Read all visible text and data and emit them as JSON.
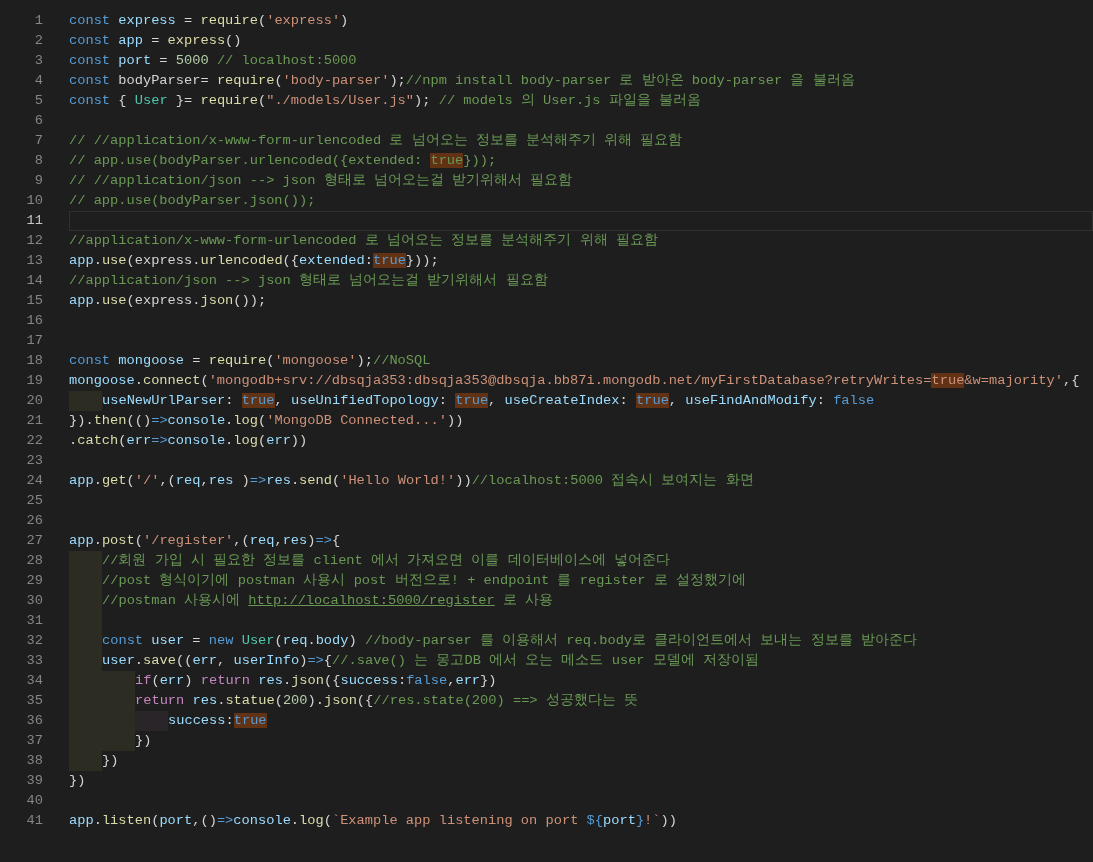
{
  "editor": {
    "lines": [
      {
        "number": "1",
        "current": false,
        "tokens": [
          {
            "text": "const",
            "kind": "keyword"
          },
          {
            "text": " express",
            "kind": "variable"
          },
          {
            "text": " = ",
            "kind": "plain"
          },
          {
            "text": "require",
            "kind": "function"
          },
          {
            "text": "(",
            "kind": "plain"
          },
          {
            "text": "'express'",
            "kind": "string"
          },
          {
            "text": ")",
            "kind": "plain"
          }
        ]
      },
      {
        "number": "2",
        "current": false,
        "tokens": [
          {
            "text": "const",
            "kind": "keyword"
          },
          {
            "text": " app",
            "kind": "variable"
          },
          {
            "text": " = ",
            "kind": "plain"
          },
          {
            "text": "express",
            "kind": "function"
          },
          {
            "text": "()",
            "kind": "plain"
          }
        ]
      },
      {
        "number": "3",
        "current": false,
        "tokens": [
          {
            "text": "const",
            "kind": "keyword"
          },
          {
            "text": " port",
            "kind": "variable"
          },
          {
            "text": " = ",
            "kind": "plain"
          },
          {
            "text": "5000",
            "kind": "number"
          },
          {
            "text": " // localhost:5000",
            "kind": "comment"
          }
        ]
      },
      {
        "number": "4",
        "current": false,
        "tokens": [
          {
            "text": "const",
            "kind": "keyword"
          },
          {
            "text": " bodyParser",
            "kind": "plain"
          },
          {
            "text": "= ",
            "kind": "plain"
          },
          {
            "text": "require",
            "kind": "function"
          },
          {
            "text": "(",
            "kind": "plain"
          },
          {
            "text": "'body-parser'",
            "kind": "string"
          },
          {
            "text": ");",
            "kind": "plain"
          },
          {
            "text": "//npm install body-parser 로 받아온 body-parser 을 불러옴",
            "kind": "comment"
          }
        ]
      },
      {
        "number": "5",
        "current": false,
        "tokens": [
          {
            "text": "const",
            "kind": "keyword"
          },
          {
            "text": " { ",
            "kind": "plain"
          },
          {
            "text": "User",
            "kind": "class"
          },
          {
            "text": " }= ",
            "kind": "plain"
          },
          {
            "text": "require",
            "kind": "function"
          },
          {
            "text": "(",
            "kind": "plain"
          },
          {
            "text": "\"./models/User.js\"",
            "kind": "string"
          },
          {
            "text": "); ",
            "kind": "plain"
          },
          {
            "text": "// models 의 User.js 파일을 불러옴",
            "kind": "comment"
          }
        ]
      },
      {
        "number": "6",
        "current": false
      },
      {
        "number": "7",
        "current": false,
        "tokens": [
          {
            "text": "// //application/x-www-form-urlencoded 로 넘어오는 정보를 분석해주기 위해 필요함",
            "kind": "comment"
          }
        ]
      },
      {
        "number": "8",
        "current": false,
        "tokens": [
          {
            "text": "// app.use(bodyParser.urlencoded({extended: ",
            "kind": "comment"
          },
          {
            "text": "true",
            "kind": "comment-match"
          },
          {
            "text": "}));",
            "kind": "comment"
          }
        ]
      },
      {
        "number": "9",
        "current": false,
        "tokens": [
          {
            "text": "// //application/json --> json 형태로 넘어오는걸 받기위해서 필요함",
            "kind": "comment"
          }
        ]
      },
      {
        "number": "10",
        "current": false,
        "tokens": [
          {
            "text": "// app.use(bodyParser.json());",
            "kind": "comment"
          }
        ]
      },
      {
        "number": "11",
        "current": true
      },
      {
        "number": "12",
        "current": false,
        "tokens": [
          {
            "text": "//application/x-www-form-urlencoded 로 넘어오는 정보를 분석해주기 위해 필요함",
            "kind": "comment"
          }
        ]
      },
      {
        "number": "13",
        "current": false,
        "tokens": [
          {
            "text": "app",
            "kind": "variable"
          },
          {
            "text": ".",
            "kind": "plain"
          },
          {
            "text": "use",
            "kind": "function"
          },
          {
            "text": "(",
            "kind": "plain"
          },
          {
            "text": "express",
            "kind": "plain"
          },
          {
            "text": ".",
            "kind": "plain"
          },
          {
            "text": "urlencoded",
            "kind": "function"
          },
          {
            "text": "({",
            "kind": "plain"
          },
          {
            "text": "extended",
            "kind": "variable"
          },
          {
            "text": ":",
            "kind": "plain"
          },
          {
            "text": "true",
            "kind": "match"
          },
          {
            "text": "}));",
            "kind": "plain"
          }
        ]
      },
      {
        "number": "14",
        "current": false,
        "tokens": [
          {
            "text": "//application/json --> json 형태로 넘어오는걸 받기위해서 필요함",
            "kind": "comment"
          }
        ]
      },
      {
        "number": "15",
        "current": false,
        "tokens": [
          {
            "text": "app",
            "kind": "variable"
          },
          {
            "text": ".",
            "kind": "plain"
          },
          {
            "text": "use",
            "kind": "function"
          },
          {
            "text": "(",
            "kind": "plain"
          },
          {
            "text": "express",
            "kind": "plain"
          },
          {
            "text": ".",
            "kind": "plain"
          },
          {
            "text": "json",
            "kind": "function"
          },
          {
            "text": "());",
            "kind": "plain"
          }
        ]
      },
      {
        "number": "16",
        "current": false
      },
      {
        "number": "17",
        "current": false
      },
      {
        "number": "18",
        "current": false,
        "tokens": [
          {
            "text": "const",
            "kind": "keyword"
          },
          {
            "text": " mongoose",
            "kind": "variable"
          },
          {
            "text": " = ",
            "kind": "plain"
          },
          {
            "text": "require",
            "kind": "function"
          },
          {
            "text": "(",
            "kind": "plain"
          },
          {
            "text": "'mongoose'",
            "kind": "string"
          },
          {
            "text": ");",
            "kind": "plain"
          },
          {
            "text": "//NoSQL",
            "kind": "comment"
          }
        ]
      },
      {
        "number": "19",
        "current": false,
        "tokens": [
          {
            "text": "mongoose",
            "kind": "variable"
          },
          {
            "text": ".",
            "kind": "plain"
          },
          {
            "text": "connect",
            "kind": "function"
          },
          {
            "text": "(",
            "kind": "plain"
          },
          {
            "text": "'mongodb+srv://dbsqja353:dbsqja353@dbsqja.bb87i.mongodb.net/myFirstDatabase?retryWrites=",
            "kind": "string"
          },
          {
            "text": "true",
            "kind": "string-match"
          },
          {
            "text": "&w=majority'",
            "kind": "string"
          },
          {
            "text": ",{",
            "kind": "plain"
          }
        ]
      },
      {
        "number": "20",
        "current": false,
        "indent_guides": [
          {
            "kind": "outer"
          }
        ],
        "tokens": [
          {
            "text": "useNewUrlParser",
            "kind": "variable"
          },
          {
            "text": ": ",
            "kind": "plain"
          },
          {
            "text": "true",
            "kind": "match"
          },
          {
            "text": ", ",
            "kind": "plain"
          },
          {
            "text": "useUnifiedTopology",
            "kind": "variable"
          },
          {
            "text": ": ",
            "kind": "plain"
          },
          {
            "text": "true",
            "kind": "match"
          },
          {
            "text": ", ",
            "kind": "plain"
          },
          {
            "text": "useCreateIndex",
            "kind": "variable"
          },
          {
            "text": ": ",
            "kind": "plain"
          },
          {
            "text": "true",
            "kind": "match"
          },
          {
            "text": ", ",
            "kind": "plain"
          },
          {
            "text": "useFindAndModify",
            "kind": "variable"
          },
          {
            "text": ": ",
            "kind": "plain"
          },
          {
            "text": "false",
            "kind": "keyword"
          }
        ]
      },
      {
        "number": "21",
        "current": false,
        "tokens": [
          {
            "text": "}).",
            "kind": "plain"
          },
          {
            "text": "then",
            "kind": "function"
          },
          {
            "text": "(()",
            "kind": "plain"
          },
          {
            "text": "=>",
            "kind": "keyword"
          },
          {
            "text": "console",
            "kind": "variable"
          },
          {
            "text": ".",
            "kind": "plain"
          },
          {
            "text": "log",
            "kind": "function"
          },
          {
            "text": "(",
            "kind": "plain"
          },
          {
            "text": "'MongoDB Connected...'",
            "kind": "string"
          },
          {
            "text": "))",
            "kind": "plain"
          }
        ]
      },
      {
        "number": "22",
        "current": false,
        "tokens": [
          {
            "text": ".",
            "kind": "plain"
          },
          {
            "text": "catch",
            "kind": "function"
          },
          {
            "text": "(",
            "kind": "plain"
          },
          {
            "text": "err",
            "kind": "variable"
          },
          {
            "text": "=>",
            "kind": "keyword"
          },
          {
            "text": "console",
            "kind": "variable"
          },
          {
            "text": ".",
            "kind": "plain"
          },
          {
            "text": "log",
            "kind": "function"
          },
          {
            "text": "(",
            "kind": "plain"
          },
          {
            "text": "err",
            "kind": "variable"
          },
          {
            "text": "))",
            "kind": "plain"
          }
        ]
      },
      {
        "number": "23",
        "current": false
      },
      {
        "number": "24",
        "current": false,
        "tokens": [
          {
            "text": "app",
            "kind": "variable"
          },
          {
            "text": ".",
            "kind": "plain"
          },
          {
            "text": "get",
            "kind": "function"
          },
          {
            "text": "(",
            "kind": "plain"
          },
          {
            "text": "'/'",
            "kind": "string"
          },
          {
            "text": ",(",
            "kind": "plain"
          },
          {
            "text": "req",
            "kind": "variable"
          },
          {
            "text": ",",
            "kind": "plain"
          },
          {
            "text": "res ",
            "kind": "variable"
          },
          {
            "text": ")",
            "kind": "plain"
          },
          {
            "text": "=>",
            "kind": "keyword"
          },
          {
            "text": "res",
            "kind": "variable"
          },
          {
            "text": ".",
            "kind": "plain"
          },
          {
            "text": "send",
            "kind": "function"
          },
          {
            "text": "(",
            "kind": "plain"
          },
          {
            "text": "'Hello World!'",
            "kind": "string"
          },
          {
            "text": "))",
            "kind": "plain"
          },
          {
            "text": "//localhost:5000 접속시 보여지는 화면",
            "kind": "comment"
          }
        ]
      },
      {
        "number": "25",
        "current": false
      },
      {
        "number": "26",
        "current": false
      },
      {
        "number": "27",
        "current": false,
        "tokens": [
          {
            "text": "app",
            "kind": "variable"
          },
          {
            "text": ".",
            "kind": "plain"
          },
          {
            "text": "post",
            "kind": "function"
          },
          {
            "text": "(",
            "kind": "plain"
          },
          {
            "text": "'/register'",
            "kind": "string"
          },
          {
            "text": ",(",
            "kind": "plain"
          },
          {
            "text": "req",
            "kind": "variable"
          },
          {
            "text": ",",
            "kind": "plain"
          },
          {
            "text": "res",
            "kind": "variable"
          },
          {
            "text": ")",
            "kind": "plain"
          },
          {
            "text": "=>",
            "kind": "keyword"
          },
          {
            "text": "{",
            "kind": "plain"
          }
        ]
      },
      {
        "number": "28",
        "current": false,
        "indent_guides": [
          {
            "kind": "outer"
          }
        ],
        "tokens": [
          {
            "text": "//회원 가입 시 필요한 정보를 client 에서 가져오면 이를 데이터베이스에 넣어준다",
            "kind": "comment"
          }
        ]
      },
      {
        "number": "29",
        "current": false,
        "indent_guides": [
          {
            "kind": "outer"
          }
        ],
        "tokens": [
          {
            "text": "//post 형식이기에 postman 사용시 post 버전으로! + endpoint 를 register 로 설정했기에",
            "kind": "comment"
          }
        ]
      },
      {
        "number": "30",
        "current": false,
        "indent_guides": [
          {
            "kind": "outer"
          }
        ],
        "tokens": [
          {
            "text": "//postman 사용시에 ",
            "kind": "comment"
          },
          {
            "text": "http://localhost:5000/register",
            "kind": "link"
          },
          {
            "text": " 로 사용",
            "kind": "comment"
          }
        ]
      },
      {
        "number": "31",
        "current": false,
        "indent_guides": [
          {
            "kind": "outer"
          }
        ]
      },
      {
        "number": "32",
        "current": false,
        "indent_guides": [
          {
            "kind": "outer"
          }
        ],
        "tokens": [
          {
            "text": "const",
            "kind": "keyword"
          },
          {
            "text": " user",
            "kind": "variable"
          },
          {
            "text": " = ",
            "kind": "plain"
          },
          {
            "text": "new",
            "kind": "keyword"
          },
          {
            "text": " User",
            "kind": "class"
          },
          {
            "text": "(",
            "kind": "plain"
          },
          {
            "text": "req",
            "kind": "variable"
          },
          {
            "text": ".",
            "kind": "plain"
          },
          {
            "text": "body",
            "kind": "variable"
          },
          {
            "text": ") ",
            "kind": "plain"
          },
          {
            "text": "//body-parser 를 이용해서 req.body로 클라이언트에서 보내는 정보를 받아준다",
            "kind": "comment"
          }
        ]
      },
      {
        "number": "33",
        "current": false,
        "indent_guides": [
          {
            "kind": "outer"
          }
        ],
        "tokens": [
          {
            "text": "user",
            "kind": "variable"
          },
          {
            "text": ".",
            "kind": "plain"
          },
          {
            "text": "save",
            "kind": "function"
          },
          {
            "text": "((",
            "kind": "plain"
          },
          {
            "text": "err",
            "kind": "variable"
          },
          {
            "text": ", ",
            "kind": "plain"
          },
          {
            "text": "userInfo",
            "kind": "variable"
          },
          {
            "text": ")",
            "kind": "plain"
          },
          {
            "text": "=>",
            "kind": "keyword"
          },
          {
            "text": "{",
            "kind": "plain"
          },
          {
            "text": "//.save() 는 몽고DB 에서 오는 메소드 user 모델에 저장이됨",
            "kind": "comment"
          }
        ]
      },
      {
        "number": "34",
        "current": false,
        "indent_guides": [
          {
            "kind": "outer"
          },
          {
            "kind": "outer"
          }
        ],
        "tokens": [
          {
            "text": "if",
            "kind": "control"
          },
          {
            "text": "(",
            "kind": "plain"
          },
          {
            "text": "err",
            "kind": "variable"
          },
          {
            "text": ") ",
            "kind": "plain"
          },
          {
            "text": "return",
            "kind": "control"
          },
          {
            "text": " res",
            "kind": "variable"
          },
          {
            "text": ".",
            "kind": "plain"
          },
          {
            "text": "json",
            "kind": "function"
          },
          {
            "text": "({",
            "kind": "plain"
          },
          {
            "text": "success",
            "kind": "variable"
          },
          {
            "text": ":",
            "kind": "plain"
          },
          {
            "text": "false",
            "kind": "keyword"
          },
          {
            "text": ",",
            "kind": "plain"
          },
          {
            "text": "err",
            "kind": "variable"
          },
          {
            "text": "})",
            "kind": "plain"
          }
        ]
      },
      {
        "number": "35",
        "current": false,
        "indent_guides": [
          {
            "kind": "outer"
          },
          {
            "kind": "outer"
          }
        ],
        "tokens": [
          {
            "text": "return",
            "kind": "control"
          },
          {
            "text": " res",
            "kind": "variable"
          },
          {
            "text": ".",
            "kind": "plain"
          },
          {
            "text": "statue",
            "kind": "function"
          },
          {
            "text": "(",
            "kind": "plain"
          },
          {
            "text": "200",
            "kind": "number"
          },
          {
            "text": ").",
            "kind": "plain"
          },
          {
            "text": "json",
            "kind": "function"
          },
          {
            "text": "({",
            "kind": "plain"
          },
          {
            "text": "//res.state(200) ==> 성공했다는 뜻",
            "kind": "comment"
          }
        ]
      },
      {
        "number": "36",
        "current": false,
        "indent_guides": [
          {
            "kind": "outer"
          },
          {
            "kind": "outer"
          },
          {
            "kind": "inner"
          }
        ],
        "tokens": [
          {
            "text": "success",
            "kind": "variable"
          },
          {
            "text": ":",
            "kind": "plain"
          },
          {
            "text": "true",
            "kind": "match"
          }
        ]
      },
      {
        "number": "37",
        "current": false,
        "indent_guides": [
          {
            "kind": "outer"
          },
          {
            "kind": "outer"
          }
        ],
        "tokens": [
          {
            "text": "})",
            "kind": "plain"
          }
        ]
      },
      {
        "number": "38",
        "current": false,
        "indent_guides": [
          {
            "kind": "outer"
          }
        ],
        "tokens": [
          {
            "text": "})",
            "kind": "plain"
          }
        ]
      },
      {
        "number": "39",
        "current": false,
        "tokens": [
          {
            "text": "})",
            "kind": "plain"
          }
        ]
      },
      {
        "number": "40",
        "current": false
      },
      {
        "number": "41",
        "current": false,
        "tokens": [
          {
            "text": "app",
            "kind": "variable"
          },
          {
            "text": ".",
            "kind": "plain"
          },
          {
            "text": "listen",
            "kind": "function"
          },
          {
            "text": "(",
            "kind": "plain"
          },
          {
            "text": "port",
            "kind": "variable"
          },
          {
            "text": ",()",
            "kind": "plain"
          },
          {
            "text": "=>",
            "kind": "keyword"
          },
          {
            "text": "console",
            "kind": "variable"
          },
          {
            "text": ".",
            "kind": "plain"
          },
          {
            "text": "log",
            "kind": "function"
          },
          {
            "text": "(",
            "kind": "plain"
          },
          {
            "text": "`Example app listening on port ",
            "kind": "string"
          },
          {
            "text": "${",
            "kind": "keyword"
          },
          {
            "text": "port",
            "kind": "variable"
          },
          {
            "text": "}",
            "kind": "keyword"
          },
          {
            "text": "!`",
            "kind": "string"
          },
          {
            "text": "))",
            "kind": "plain"
          }
        ]
      }
    ]
  }
}
